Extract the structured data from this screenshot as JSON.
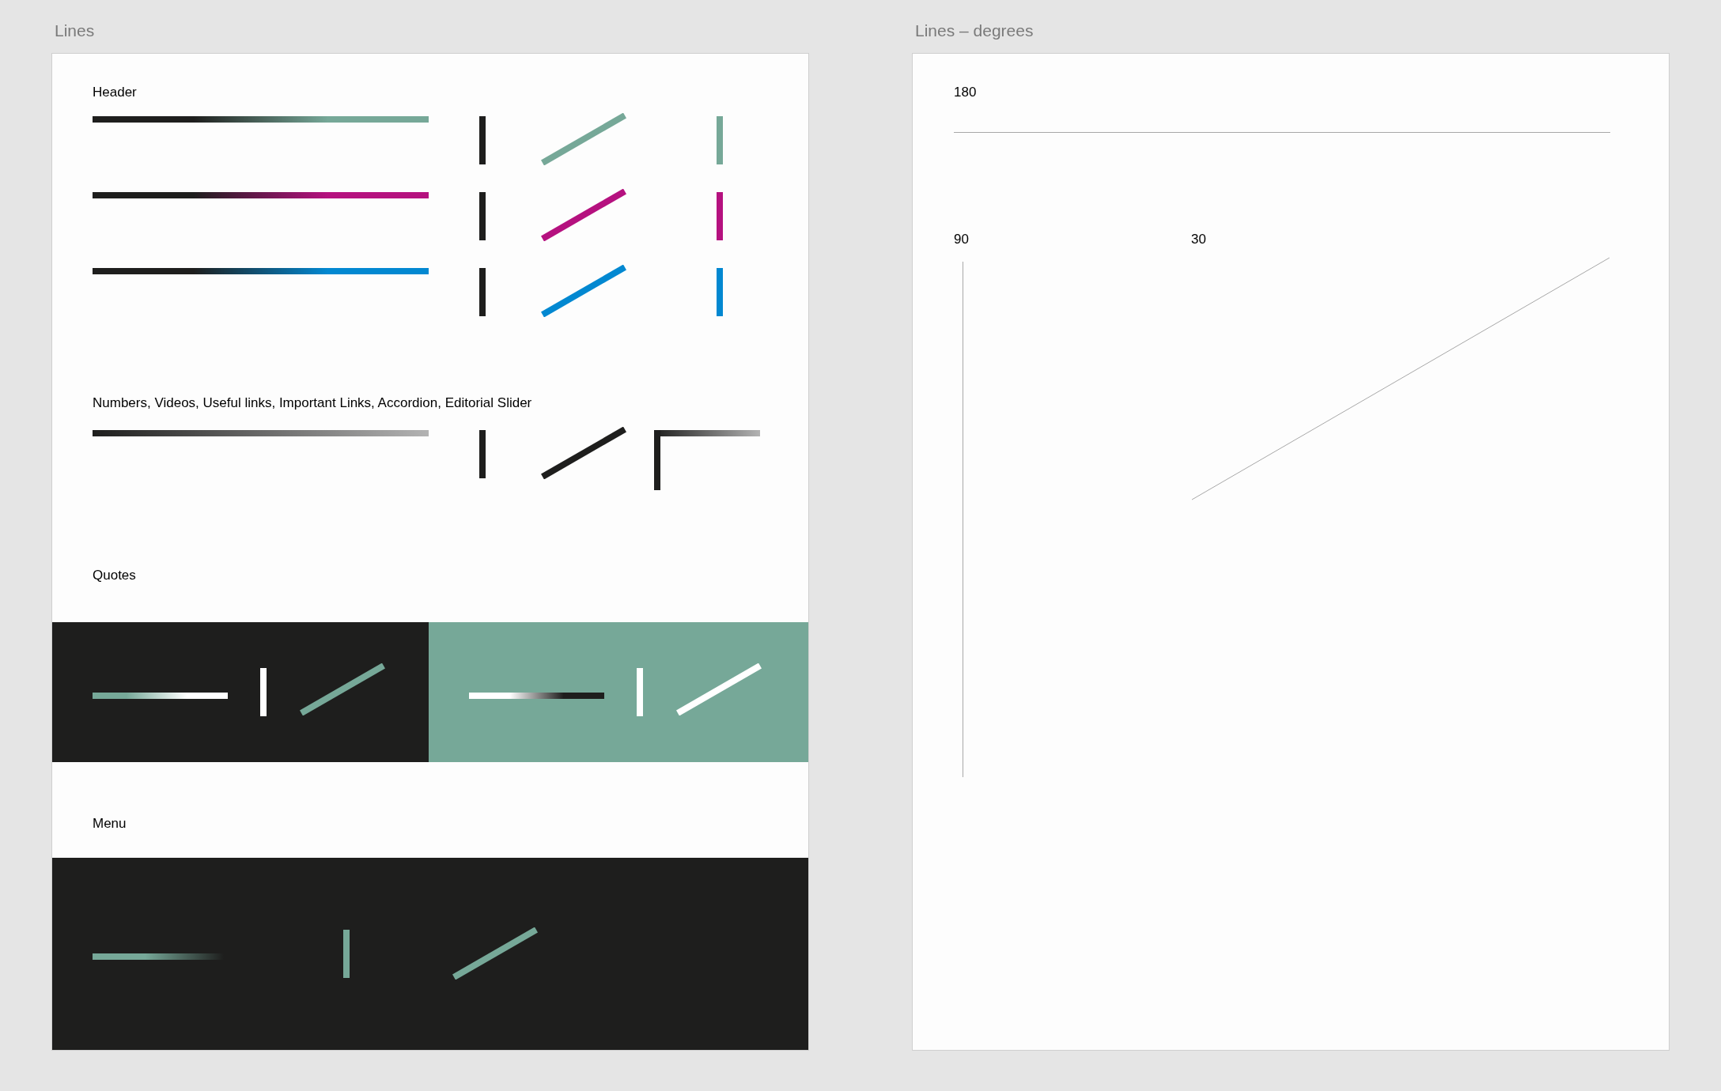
{
  "artboards": [
    {
      "title": "Lines",
      "kind": "swatches",
      "sections": [
        {
          "label": "Header",
          "kind": "rows",
          "rows": [
            {
              "color": "#76a898"
            },
            {
              "color": "#b5117f"
            },
            {
              "color": "#0288d1"
            }
          ]
        },
        {
          "label": "Numbers, Videos, Useful links, Important Links, Accordion, Editorial Slider",
          "kind": "corner"
        },
        {
          "label": "Quotes",
          "kind": "panels",
          "panels": [
            {
              "kind": "dark"
            },
            {
              "kind": "green"
            }
          ]
        },
        {
          "label": "Menu",
          "kind": "menu"
        }
      ]
    },
    {
      "title": "Lines – degrees",
      "kind": "degrees",
      "items": [
        {
          "label": "180",
          "kind": "horizontal"
        },
        {
          "label": "90",
          "kind": "vertical"
        },
        {
          "label": "30",
          "kind": "diagonal"
        }
      ]
    }
  ]
}
